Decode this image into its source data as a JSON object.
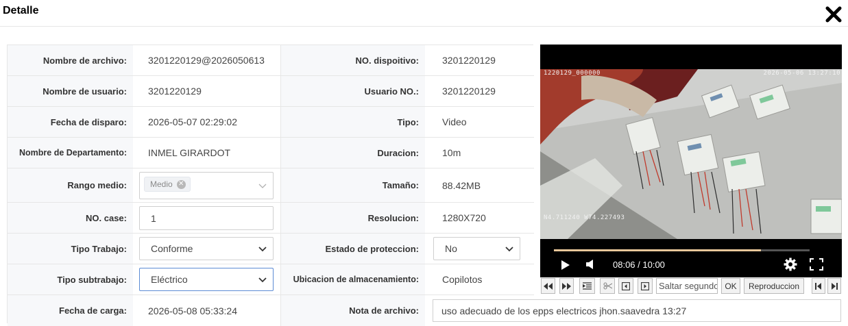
{
  "header": {
    "title": "Detalle",
    "close_icon": "close-icon"
  },
  "fields": {
    "nombre_archivo": {
      "label": "Nombre de archivo:",
      "value": "3201220129@2026050613"
    },
    "no_dispositivo": {
      "label": "NO. dispoitivo:",
      "value": "3201220129"
    },
    "nombre_usuario": {
      "label": "Nombre de usuario:",
      "value": "3201220129"
    },
    "usuario_no": {
      "label": "Usuario NO.:",
      "value": "3201220129"
    },
    "fecha_disparo": {
      "label": "Fecha de disparo:",
      "value": "2026-05-07 02:29:02"
    },
    "tipo": {
      "label": "Tipo:",
      "value": "Video"
    },
    "departamento": {
      "label": "Nombre de Departamento:",
      "value": "INMEL GIRARDOT"
    },
    "duracion": {
      "label": "Duracion:",
      "value": "10m"
    },
    "rango_medio": {
      "label": "Rango medio:",
      "tag": "Medio"
    },
    "tamano": {
      "label": "Tamaño:",
      "value": "88.42MB"
    },
    "no_case": {
      "label": "NO. case:",
      "value": "1"
    },
    "resolucion": {
      "label": "Resolucion:",
      "value": "1280X720"
    },
    "tipo_trabajo": {
      "label": "Tipo Trabajo:",
      "value": "Conforme"
    },
    "estado_proteccion": {
      "label": "Estado de proteccion:",
      "value": "No"
    },
    "tipo_subtrabajo": {
      "label": "Tipo subtrabajo:",
      "value": "Eléctrico"
    },
    "ubicacion": {
      "label": "Ubicacion de almacenamiento:",
      "value": "Copilotos"
    },
    "fecha_carga": {
      "label": "Fecha de carga:",
      "value": "2026-05-08 05:33:24"
    },
    "nota_archivo": {
      "label": "Nota de archivo:",
      "value": "uso adecuado de los epps electricos jhon.saavedra 13:27"
    }
  },
  "player": {
    "osd_top_left": "1220129_000000",
    "osd_top_right": "2026-05-06 13:27:10",
    "osd_bottom_left": "N4.711240 W74.227493",
    "time": "08:06 / 10:00",
    "progress_fraction": 0.81,
    "icons": [
      "play-icon",
      "volume-icon",
      "gear-icon",
      "fullscreen-icon"
    ]
  },
  "toolbar": {
    "seek_placeholder": "Saltar segundos",
    "ok_label": "OK",
    "playback_label": "Reproduccion",
    "icons": [
      "rewind-icon",
      "fast-forward-icon",
      "list-icon",
      "scissors-icon",
      "prev-frame-icon",
      "next-frame-icon",
      "skip-start-icon",
      "skip-end-icon"
    ]
  }
}
